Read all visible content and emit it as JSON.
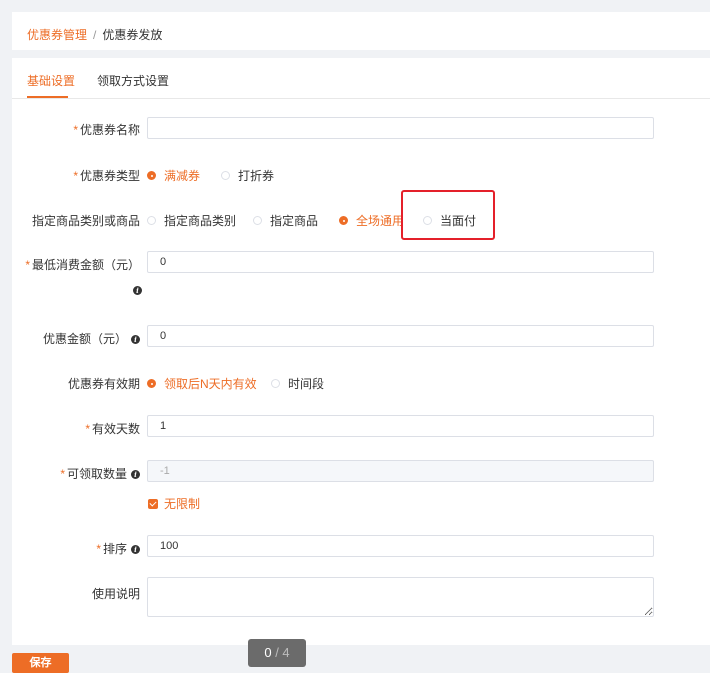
{
  "breadcrumb": {
    "parent": "优惠券管理",
    "separator": "/",
    "current": "优惠券发放"
  },
  "tabs": [
    {
      "label": "基础设置",
      "active": true
    },
    {
      "label": "领取方式设置",
      "active": false
    }
  ],
  "form": {
    "name": {
      "label": "优惠券名称",
      "required": true,
      "value": ""
    },
    "type": {
      "label": "优惠券类型",
      "required": true,
      "options": [
        "满减券",
        "打折券"
      ],
      "selected": "满减券"
    },
    "scope": {
      "label": "指定商品类别或商品",
      "required": false,
      "options": [
        "指定商品类别",
        "指定商品",
        "全场通用",
        "当面付"
      ],
      "selected": "全场通用"
    },
    "min_spend": {
      "label": "最低消费金额（元）",
      "required": true,
      "value": "0"
    },
    "discount": {
      "label": "优惠金额（元）",
      "required": false,
      "value": "0"
    },
    "validity": {
      "label": "优惠券有效期",
      "required": false,
      "options": [
        "领取后N天内有效",
        "时间段"
      ],
      "selected": "领取后N天内有效"
    },
    "valid_days": {
      "label": "有效天数",
      "required": true,
      "value": "1"
    },
    "quantity": {
      "label": "可领取数量",
      "required": true,
      "value": "-1",
      "disabled": true
    },
    "unlimited": {
      "label": "无限制",
      "checked": true
    },
    "sort": {
      "label": "排序",
      "required": true,
      "value": "100"
    },
    "description": {
      "label": "使用说明",
      "required": false,
      "value": ""
    }
  },
  "save_label": "保存",
  "pager": {
    "current": "0",
    "sep": " / ",
    "total": "4"
  },
  "colors": {
    "accent": "#ed6d26",
    "highlight": "#e4202a"
  },
  "icons": {
    "info": "info-icon"
  }
}
